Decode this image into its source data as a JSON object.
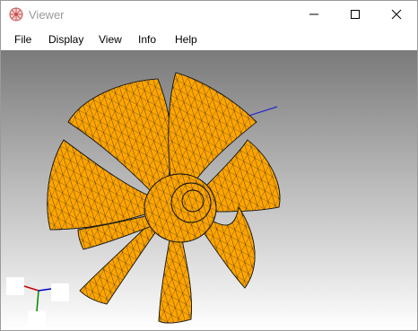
{
  "window": {
    "title": "Viewer",
    "controls": {
      "minimize": "minimize-icon",
      "maximize": "maximize-icon",
      "close": "close-icon"
    }
  },
  "menubar": {
    "items": [
      {
        "label": "File"
      },
      {
        "label": "Display"
      },
      {
        "label": "View"
      },
      {
        "label": "Info"
      },
      {
        "label": "Help"
      }
    ]
  },
  "viewport": {
    "model": "fan",
    "model_fill_color": "#ffa500",
    "wireframe_color": "#1a1a1a",
    "background_top": "#7a7a7a",
    "background_bottom": "#ffffff",
    "axis_colors": {
      "x": "#cc0000",
      "y": "#008800",
      "z": "#0000cc"
    }
  }
}
